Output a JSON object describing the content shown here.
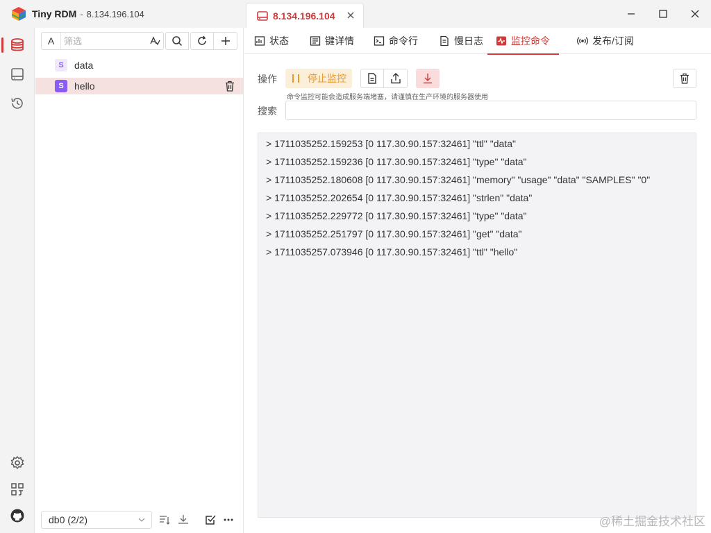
{
  "app": {
    "name": "Tiny RDM",
    "separator": "-",
    "host": "8.134.196.104"
  },
  "connection_tab": {
    "label": "8.134.196.104"
  },
  "filter": {
    "type_label": "A",
    "placeholder": "筛选",
    "regex_label": "A"
  },
  "keys": [
    {
      "type": "S",
      "name": "data",
      "selected": false
    },
    {
      "type": "S",
      "name": "hello",
      "selected": true
    }
  ],
  "db_select": {
    "value": "db0 (2/2)"
  },
  "subtabs": [
    {
      "label": "状态",
      "icon": "status-icon"
    },
    {
      "label": "键详情",
      "icon": "key-detail-icon"
    },
    {
      "label": "命令行",
      "icon": "terminal-icon"
    },
    {
      "label": "慢日志",
      "icon": "slow-log-icon"
    },
    {
      "label": "监控命令",
      "icon": "monitor-icon",
      "active": true
    },
    {
      "label": "发布/订阅",
      "icon": "broadcast-icon"
    }
  ],
  "monitor": {
    "ops_label": "操作",
    "stop_label": "停止监控",
    "warning": "命令监控可能会造成服务端堵塞，请谨慎在生产环境的服务器使用",
    "search_label": "搜索",
    "search_value": "",
    "logs": [
      "> 1711035252.159253 [0 117.30.90.157:32461] \"ttl\" \"data\"",
      "> 1711035252.159236 [0 117.30.90.157:32461] \"type\" \"data\"",
      "> 1711035252.180608 [0 117.30.90.157:32461] \"memory\" \"usage\" \"data\" \"SAMPLES\" \"0\"",
      "> 1711035252.202654 [0 117.30.90.157:32461] \"strlen\" \"data\"",
      "> 1711035252.229772 [0 117.30.90.157:32461] \"type\" \"data\"",
      "> 1711035252.251797 [0 117.30.90.157:32461] \"get\" \"data\"",
      "> 1711035257.073946 [0 117.30.90.157:32461] \"ttl\" \"hello\""
    ]
  },
  "watermark": "@稀土掘金技术社区",
  "colors": {
    "accent": "#d03a3a",
    "warning": "#e79a2e",
    "set_type": "#8a5cf5"
  }
}
